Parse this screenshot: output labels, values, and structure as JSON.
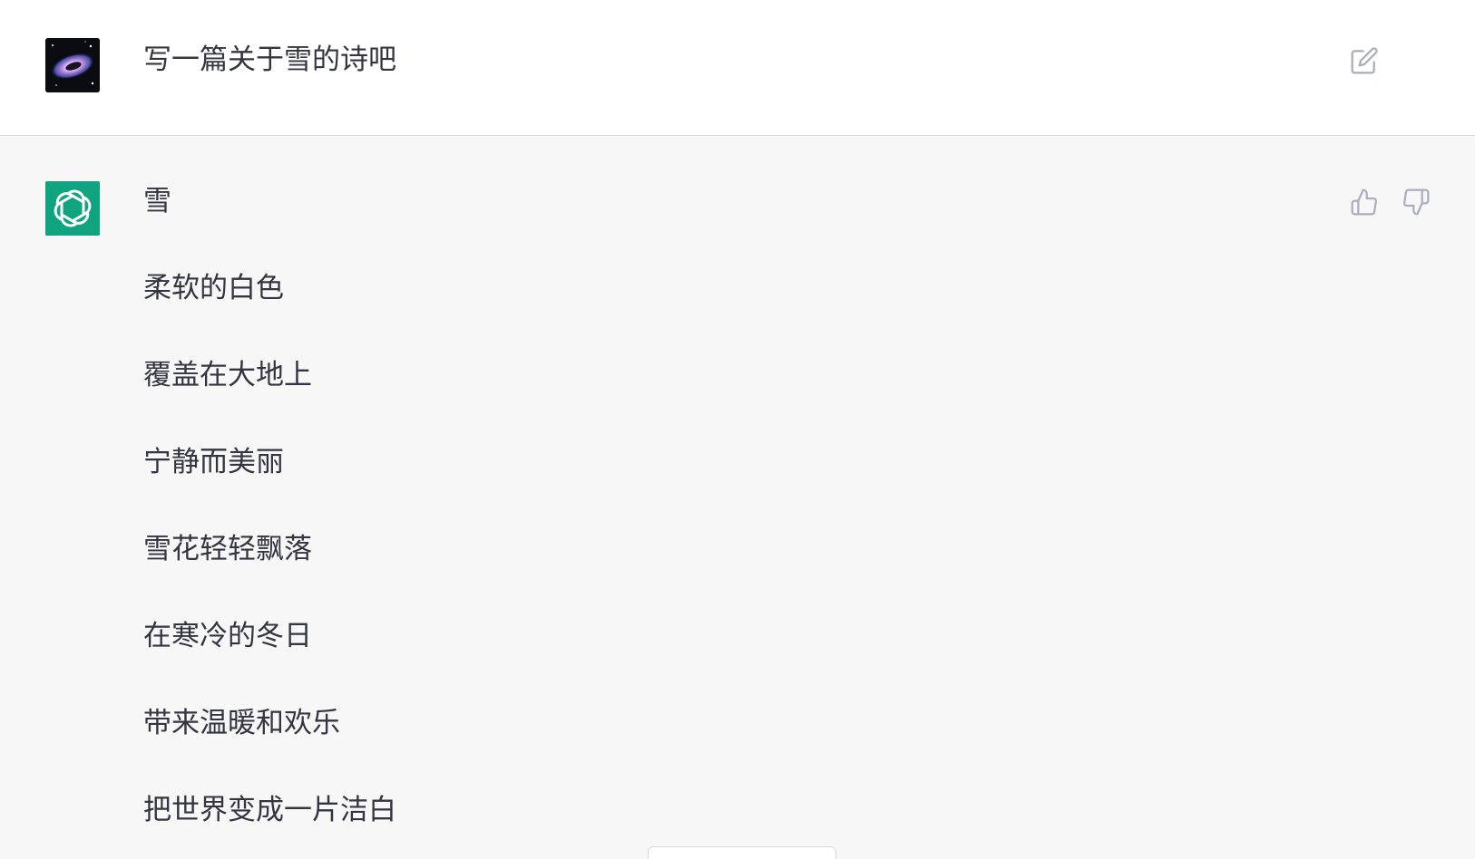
{
  "user_message": {
    "avatar_icon": "galaxy-avatar-icon",
    "text": "写一篇关于雪的诗吧",
    "edit_icon": "edit-icon"
  },
  "assistant_message": {
    "avatar_icon": "openai-logo-icon",
    "avatar_color": "#10a37f",
    "lines": [
      "雪",
      "柔软的白色",
      "覆盖在大地上",
      "宁静而美丽",
      "雪花轻轻飘落",
      "在寒冷的冬日",
      "带来温暖和欢乐",
      "把世界变成一片洁白"
    ],
    "thumbs_up_icon": "thumbs-up-icon",
    "thumbs_down_icon": "thumbs-down-icon"
  },
  "colors": {
    "user_bg": "#ffffff",
    "assistant_bg": "#f7f7f8",
    "text": "#343541",
    "icon": "#acacbe"
  }
}
